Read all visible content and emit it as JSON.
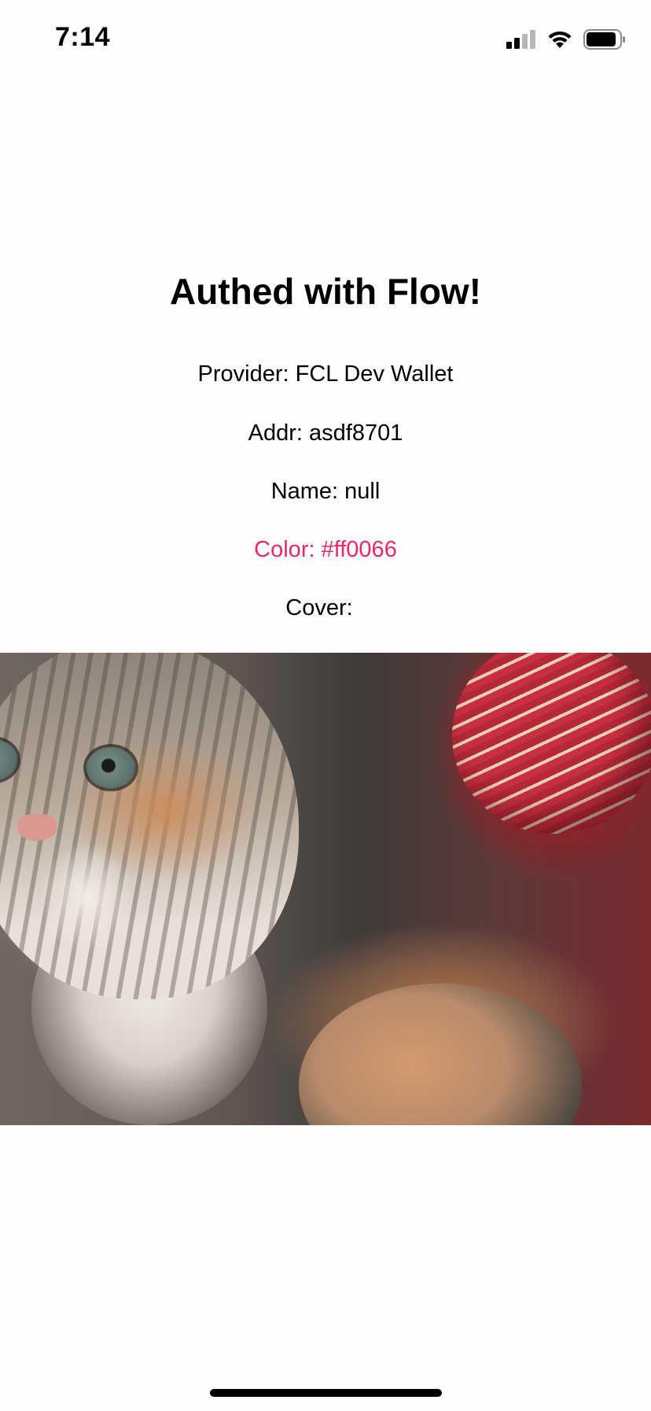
{
  "status_bar": {
    "time": "7:14",
    "icons": [
      "signal-icon",
      "wifi-icon",
      "battery-icon"
    ]
  },
  "main": {
    "title": "Authed with Flow!",
    "provider": "Provider: FCL Dev Wallet",
    "addr": "Addr: asdf8701",
    "name": "Name: null",
    "color": "Color: #ff0066",
    "cover_label": "Cover:",
    "cover_image": "kitten-cover-image"
  },
  "colors": {
    "accent_text": "#e5286c",
    "background": "#fefdfe"
  }
}
